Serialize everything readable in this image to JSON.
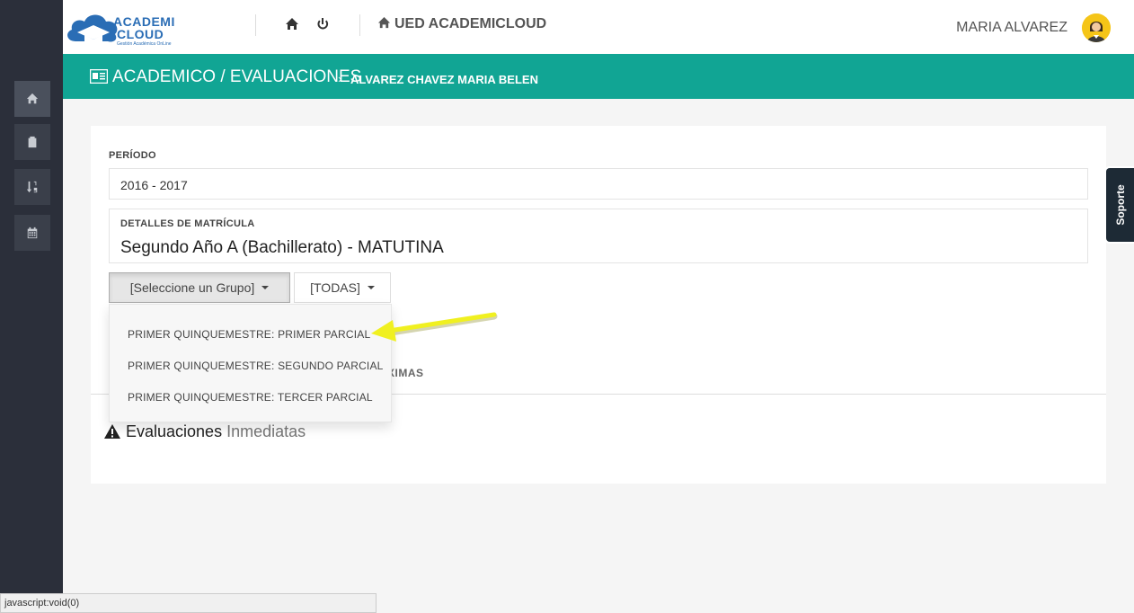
{
  "sidebar": {
    "items": [
      {
        "name": "home",
        "icon": "home-icon"
      },
      {
        "name": "clipboard",
        "icon": "clipboard-icon"
      },
      {
        "name": "sort",
        "icon": "sort-numeric-icon"
      },
      {
        "name": "calendar",
        "icon": "calendar-icon"
      }
    ]
  },
  "header": {
    "logo_line1": "ACADEMI",
    "logo_line2": "CLOUD",
    "logo_sub": "Gestión Académica OnLine",
    "app_title": "UED ACADEMICLOUD",
    "user_name": "MARIA ALVAREZ"
  },
  "titlebar": {
    "main": "ACADEMICO / EVALUACIONES",
    "separator": "›",
    "sub": "ALVAREZ CHAVEZ MARIA BELEN"
  },
  "form": {
    "periodo_label": "PERÍODO",
    "periodo_value": "2016 - 2017",
    "matricula_label": "DETALLES DE MATRÍCULA",
    "matricula_value": "Segundo Año A (Bachillerato) - MATUTINA",
    "group_button": "[Seleccione un Grupo]",
    "todas_button": "[TODAS]"
  },
  "dropdown": {
    "items": [
      "PRIMER QUINQUEMESTRE: PRIMER PARCIAL",
      "PRIMER QUINQUEMESTRE: SEGUNDO PARCIAL",
      "PRIMER QUINQUEMESTRE: TERCER PARCIAL"
    ]
  },
  "lower": {
    "tab_partial": "XIMAS",
    "eval_title_main": "Evaluaciones",
    "eval_title_light": "Inmediatas"
  },
  "soporte_label": "Soporte",
  "status_bar": "javascript:void(0)",
  "colors": {
    "teal": "#11a594",
    "sidebar": "#2b2f3a",
    "arrow": "#f0f020",
    "avatar": "#f5c518"
  }
}
